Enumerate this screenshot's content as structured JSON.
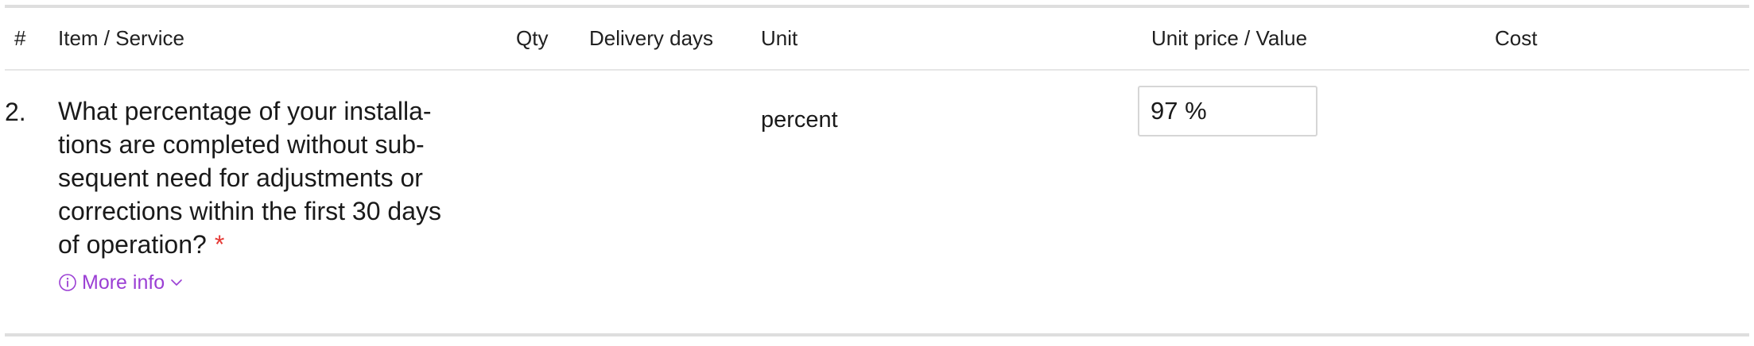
{
  "table": {
    "headers": {
      "number": "#",
      "item": "Item / Service",
      "qty": "Qty",
      "delivery": "Delivery days",
      "unit": "Unit",
      "price": "Unit price / Value",
      "cost": "Cost"
    },
    "rows": [
      {
        "number": "2.",
        "question_lines": [
          "What percentage of your installa-",
          "tions are completed without sub-",
          "sequent need for adjustments or",
          "corrections within the first 30 days",
          "of operation?"
        ],
        "required_marker": "*",
        "more_info_label": "More info",
        "more_info_icon": "info-circle-icon",
        "more_info_chevron": "chevron-down-icon",
        "qty": "",
        "delivery_days": "",
        "unit": "percent",
        "value": "97 %",
        "cost": ""
      }
    ]
  },
  "colors": {
    "accent": "#9b3fd4",
    "required": "#e53935",
    "rule": "#dedede"
  }
}
